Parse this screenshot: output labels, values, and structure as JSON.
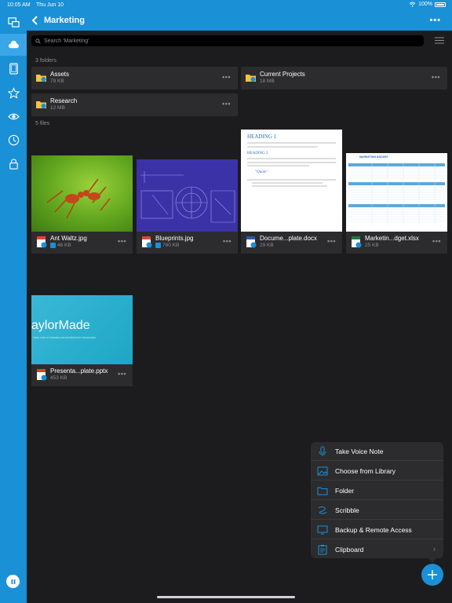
{
  "status": {
    "time": "10:05 AM",
    "date": "Thu Jun 10",
    "battery": "100%"
  },
  "header": {
    "title": "Marketing",
    "more": "•••"
  },
  "search": {
    "placeholder": "Search 'Marketing'"
  },
  "sections": {
    "folders_label": "3 folders",
    "files_label": "5 files"
  },
  "folders": [
    {
      "name": "Assets",
      "size": "79 KB"
    },
    {
      "name": "Current Projects",
      "size": "18 MB"
    },
    {
      "name": "Research",
      "size": "12 MB"
    }
  ],
  "files": [
    {
      "name": "Ant Waltz.jpg",
      "size": "46 KB",
      "type": "jpg"
    },
    {
      "name": "Blueprints.jpg",
      "size": "760 KB",
      "type": "jpg"
    },
    {
      "name": "Docume...plate.docx",
      "size": "29 KB",
      "type": "docx"
    },
    {
      "name": "Marketin...dget.xlsx",
      "size": "25 KB",
      "type": "xlsx"
    },
    {
      "name": "Presenta...plate.pptx",
      "size": "453 KB",
      "type": "pptx"
    }
  ],
  "thumbnails": {
    "doc_heading1": "HEADING 1",
    "doc_heading2": "HEADING 2",
    "doc_quote": "\"Quote\"",
    "pptx_title": "aylorMade",
    "pptx_subtitle": "TECH CIRCUIT WOMEN AND WOODSTOCK PROGRAMS",
    "xlsx_title": "MARKETING BUDGET"
  },
  "menu": {
    "items": [
      {
        "label": "Take Voice Note",
        "icon": "microphone-icon"
      },
      {
        "label": "Choose from Library",
        "icon": "photo-library-icon"
      },
      {
        "label": "Folder",
        "icon": "folder-icon"
      },
      {
        "label": "Scribble",
        "icon": "scribble-icon"
      },
      {
        "label": "Backup & Remote Access",
        "icon": "monitor-icon"
      },
      {
        "label": "Clipboard",
        "icon": "clipboard-icon",
        "chevron": "›"
      }
    ]
  },
  "colors": {
    "accent": "#1a90d6",
    "background": "#1c1c1e",
    "card": "#2c2c2e"
  }
}
